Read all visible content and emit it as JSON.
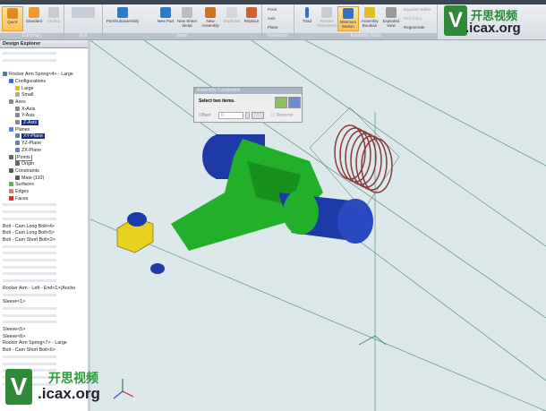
{
  "ribbon": {
    "groups": {
      "constrain": "Constrain",
      "edit": "Edit",
      "insert": "Insert",
      "reference": "Reference",
      "assembly_tools": "Assembly Tools"
    },
    "buttons": {
      "quick": "Quick",
      "standard": "Standard",
      "anchor": "Anchor",
      "part_subassembly": "Part/Subassembly",
      "new_part": "New Part",
      "new_sheet_metal": "New Sheet Metal",
      "new_assembly": "New Assembly",
      "duplicate": "Duplicate",
      "replace": "Replace",
      "point": "Point",
      "axis": "Axis",
      "plane": "Plane",
      "triad": "Triad",
      "precise_placement": "Precise Placement",
      "minimum_motion": "Minimum Motion",
      "assembly_boolean": "Assembly Boolean",
      "exploded_view": "Exploded View",
      "equation_editor": "Equation Editor",
      "part_color": "Part Color",
      "regenerate": "Regenerate"
    }
  },
  "watermark": {
    "text_cn": "开思视频",
    "text_url": ".icax.org",
    "letter": "V"
  },
  "explorer": {
    "title": "Design Explorer",
    "rows": [
      {
        "y": 0,
        "faded": true
      },
      {
        "y": 1,
        "faded": true
      },
      {
        "y": 3,
        "text": "Rocker Arm Spring<4> - Large",
        "color": "#5577aa"
      },
      {
        "y": 4,
        "text": "Configurations",
        "ind": 1,
        "color": "#3b6fc9"
      },
      {
        "y": 5,
        "text": "Large",
        "ind": 2,
        "color": "#d4c020"
      },
      {
        "y": 6,
        "text": "Small",
        "ind": 2,
        "color": "#aaa"
      },
      {
        "y": 7,
        "text": "Axes",
        "ind": 1,
        "color": "#888"
      },
      {
        "y": 8,
        "text": "X-Axis",
        "ind": 2,
        "color": "#888"
      },
      {
        "y": 9,
        "text": "Y-Axis",
        "ind": 2,
        "color": "#888"
      },
      {
        "y": 10,
        "text": "Z-Axis",
        "ind": 2,
        "color": "#888",
        "sel": true
      },
      {
        "y": 11,
        "text": "Planes",
        "ind": 1,
        "color": "#5b7fd6"
      },
      {
        "y": 12,
        "text": "XY-Plane",
        "ind": 2,
        "color": "#5b7fd6",
        "sel": true
      },
      {
        "y": 13,
        "text": "YZ-Plane",
        "ind": 2,
        "color": "#5b7fd6"
      },
      {
        "y": 14,
        "text": "ZX-Plane",
        "ind": 2,
        "color": "#5b7fd6"
      },
      {
        "y": 15,
        "text": "Points",
        "ind": 1,
        "color": "#666",
        "box": true
      },
      {
        "y": 16,
        "text": "Origin",
        "ind": 2,
        "color": "#666"
      },
      {
        "y": 17,
        "text": "Constraints",
        "ind": 1,
        "color": "#555"
      },
      {
        "y": 18,
        "text": "Mate (110)",
        "ind": 2,
        "color": "#555"
      },
      {
        "y": 19,
        "text": "Surfaces",
        "ind": 1,
        "color": "#6a6"
      },
      {
        "y": 20,
        "text": "Edges",
        "ind": 1,
        "color": "#d77"
      },
      {
        "y": 21,
        "text": "Faces",
        "ind": 1,
        "color": "#e22"
      },
      {
        "y": 22,
        "faded": true
      },
      {
        "y": 23,
        "faded": true
      },
      {
        "y": 24,
        "faded": true
      },
      {
        "y": 25,
        "text": "Bolt - Cam Long Bolt<4>"
      },
      {
        "y": 26,
        "text": "Bolt - Cam Long Bolt<5>"
      },
      {
        "y": 27,
        "text": "Bolt - Cam Short Bolt<2>"
      },
      {
        "y": 28,
        "faded": true
      },
      {
        "y": 29,
        "faded": true
      },
      {
        "y": 30,
        "faded": true
      },
      {
        "y": 31,
        "faded": true
      },
      {
        "y": 32,
        "faded": true
      },
      {
        "y": 33,
        "faded": true
      },
      {
        "y": 34,
        "text": "Rocker Arm - Left - End<1>(Ancho"
      },
      {
        "y": 35,
        "faded": true
      },
      {
        "y": 36,
        "text": "Sleeve<1>"
      },
      {
        "y": 37,
        "faded": true
      },
      {
        "y": 38,
        "faded": true
      },
      {
        "y": 39,
        "faded": true
      },
      {
        "y": 40,
        "text": "Sleeve<5>"
      },
      {
        "y": 41,
        "text": "Sleeve<6>"
      },
      {
        "y": 42,
        "text": "Rocker Arm Spring<7> - Large"
      },
      {
        "y": 43,
        "text": "Bolt - Cam Short Bolt<6>"
      },
      {
        "y": 44,
        "faded": true
      },
      {
        "y": 45,
        "faded": true
      },
      {
        "y": 46,
        "faded": true
      },
      {
        "y": 47,
        "faded": true
      },
      {
        "y": 48,
        "faded": true
      }
    ]
  },
  "dialog": {
    "title": "Assembly Constraints",
    "prompt": "Select two items.",
    "offset_label": "Offset",
    "offset_value": "0",
    "reverse_label": "Reverse"
  },
  "colors": {
    "arm": "#22b02a",
    "shaft": "#1e3aa8",
    "spring": "#8a3a3a",
    "nut": "#e8d020"
  }
}
